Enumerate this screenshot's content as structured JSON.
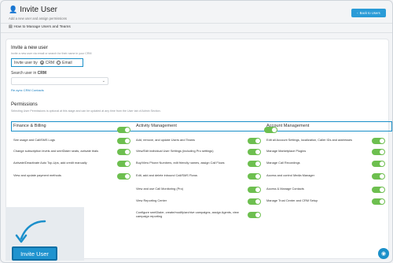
{
  "header": {
    "title": "Invite User",
    "subtitle": "Add a new user and assign permissions",
    "back_label": "Back to Users",
    "howto": "How to Manage Users and Teams"
  },
  "invite": {
    "title": "Invite a new user",
    "desc": "Invite a new user via email or search for their name in your CRM",
    "invite_by_label": "Invite user by",
    "option_crm": "CRM",
    "option_email": "Email",
    "search_label": "Search user in",
    "search_bold": "CRM",
    "select_value": "",
    "resync": "Re-sync CRM Contacts"
  },
  "permissions": {
    "title": "Permissions",
    "desc": "Selecting User Permissions is optional at this stage and can be updated at any time from the User tab of Admin Section.",
    "columns": [
      {
        "head": "Finance & Billing",
        "items": [
          "See usage and Call/SMS Logs",
          "Change subscription levels and smrtDialer seats, activate trials",
          "Activate/Deactivate Auto Top-Ups, add credit manually",
          "View and update payment methods"
        ]
      },
      {
        "head": "Activity Management",
        "items": [
          "Add, remove, and update Users and Teams",
          "View/Edit individual User Settings (including Pro settings)",
          "Buy/View Phone Numbers, edit friendly names, assign Call Flows",
          "Edit, add and delete inbound Call/SMS Flows",
          "View and use Call Monitoring (Pro)",
          "View Reporting Center",
          "Configure smrtDialer, create/modify/archive campaigns, assign Agents, view campaign reporting"
        ]
      },
      {
        "head": "Account Management",
        "items": [
          "Edit all Account Settings, localization, Caller IDs and addresses",
          "Manage Marketplace Plugins",
          "Manage Call Recordings",
          "Access and control Media Manager",
          "Access & Manage Contacts",
          "Manage Trust Center and CRM Setup"
        ]
      }
    ]
  },
  "actions": {
    "invite_button": "Invite User"
  },
  "colors": {
    "accent": "#1b90c9",
    "toggle_on": "#6dbf4f"
  }
}
